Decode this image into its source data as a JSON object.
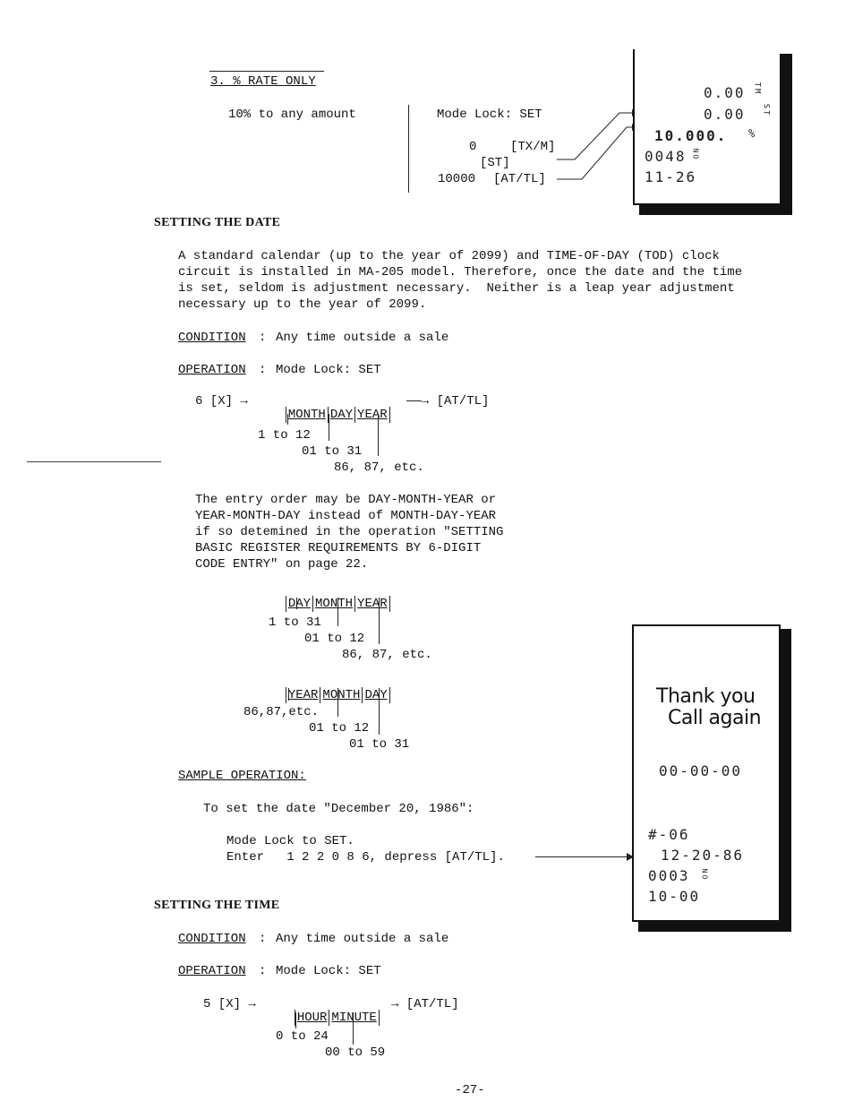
{
  "rate_section": {
    "heading": "3. % RATE ONLY",
    "description": "10% to any amount",
    "mode_lock": "Mode Lock: SET",
    "steps": [
      {
        "value": "0",
        "key": "[TX/M]"
      },
      {
        "value": "",
        "key": "[ST]"
      },
      {
        "value": "10000",
        "key": "[AT/TL]"
      }
    ],
    "receipt": {
      "lines": [
        {
          "amount": "0.00",
          "tag": "TM"
        },
        {
          "amount": "0.00",
          "tag": "ST"
        },
        {
          "amount": "10.000.",
          "tag": "%"
        },
        {
          "amount": "0048",
          "tag": "NO"
        },
        {
          "amount": "11-26",
          "tag": ""
        }
      ]
    }
  },
  "setting_date": {
    "heading": "SETTING THE DATE",
    "intro": [
      "A standard calendar (up to the year of 2099) and TIME-OF-DAY (TOD) clock",
      "circuit is installed in MA-205 model. Therefore, once the date and the time",
      "is set, seldom is adjustment necessary.  Neither is a leap year adjustment",
      "necessary up to the year of 2099."
    ],
    "condition_label": "CONDITION",
    "condition_text": "Any time outside a sale",
    "operation_label": "OPERATION",
    "operation_text": "Mode Lock: SET",
    "sequence": {
      "prefix": "6 [X] →",
      "fields": [
        "MONTH",
        "DAY",
        "YEAR"
      ],
      "suffix": "——→ [AT/TL]",
      "ranges": [
        "1 to 12",
        "01 to 31",
        "86, 87, etc."
      ]
    },
    "entry_order_note": [
      "The entry order may be DAY-MONTH-YEAR or",
      "YEAR-MONTH-DAY instead of MONTH-DAY-YEAR",
      "if so detemined in the operation \"SETTING",
      "BASIC REGISTER REQUIREMENTS BY 6-DIGIT",
      "CODE ENTRY\" on page 22."
    ],
    "alt_order_1": {
      "fields": [
        "DAY",
        "MONTH",
        "YEAR"
      ],
      "ranges": [
        "1 to 31",
        "01 to 12",
        "86, 87, etc."
      ]
    },
    "alt_order_2": {
      "fields": [
        "YEAR",
        "MONTH",
        "DAY"
      ],
      "ranges": [
        "86,87,etc.",
        "01 to 12",
        "01 to 31"
      ]
    },
    "sample_label": "SAMPLE OPERATION:",
    "sample_intro": "To set the date \"December 20, 1986\":",
    "sample_steps": [
      "Mode Lock to SET.",
      "Enter   1 2 2 0 8 6, depress [AT/TL]."
    ],
    "receipt": {
      "message_line1": "Thank you",
      "message_line2": "Call again",
      "date_blank": "00-00-00",
      "lines": [
        "#-06",
        "12-20-86",
        "0003",
        "10-00"
      ],
      "no_tag": "NO"
    }
  },
  "setting_time": {
    "heading": "SETTING THE TIME",
    "condition_label": "CONDITION",
    "condition_text": "Any time outside a sale",
    "operation_label": "OPERATION",
    "operation_text": "Mode Lock: SET",
    "sequence": {
      "prefix": "5 [X] →",
      "fields": [
        "HOUR",
        "MINUTE"
      ],
      "suffix": "→ [AT/TL]",
      "ranges": [
        "0 to 24",
        "00 to 59"
      ]
    }
  },
  "page_number": "-27-"
}
